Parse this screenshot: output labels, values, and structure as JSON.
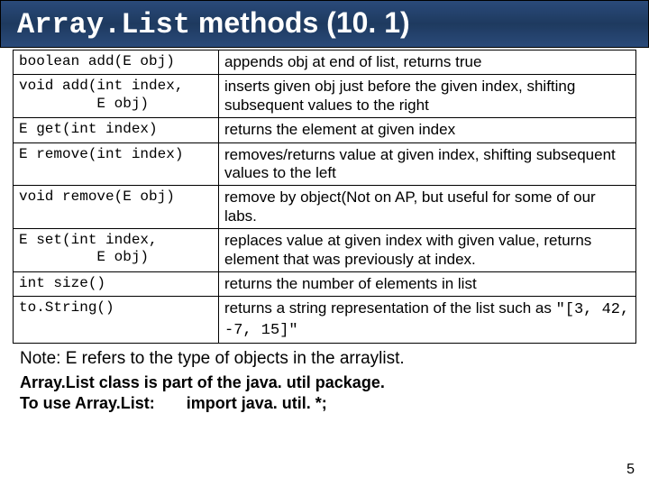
{
  "title": {
    "prefix": "Array.List",
    "suffix": " methods (10. 1)"
  },
  "rows": [
    {
      "sig": "boolean add(E obj)",
      "desc": "appends obj at end of list, returns true"
    },
    {
      "sig": "void add(int index,\n         E obj)",
      "desc": "inserts given obj just before the given index, shifting subsequent values to the right"
    },
    {
      "sig": "E get(int index)",
      "desc": "returns the element at given index"
    },
    {
      "sig": "E remove(int index)",
      "desc": "removes/returns value at given index, shifting subsequent values to the left"
    },
    {
      "sig": "void remove(E obj)",
      "desc": "remove by object(Not on AP, but useful for some of our labs."
    },
    {
      "sig": "E set(int index,\n         E obj)",
      "desc": "replaces value at given index with given value, returns element that was previously at index."
    },
    {
      "sig": "int size()",
      "desc": "returns the number of elements in list"
    },
    {
      "sig": "to.String()",
      "desc_pre": "returns a string representation of the list such as ",
      "desc_code": "\"[3, 42, -7, 15]\""
    }
  ],
  "note": "Note: E refers to the type of objects in the arraylist.",
  "footer": {
    "line1": "Array.List class is part of the java. util package.",
    "line2_a": "To use Array.List:",
    "line2_b": "import java. util. *;"
  },
  "page_num": "5"
}
